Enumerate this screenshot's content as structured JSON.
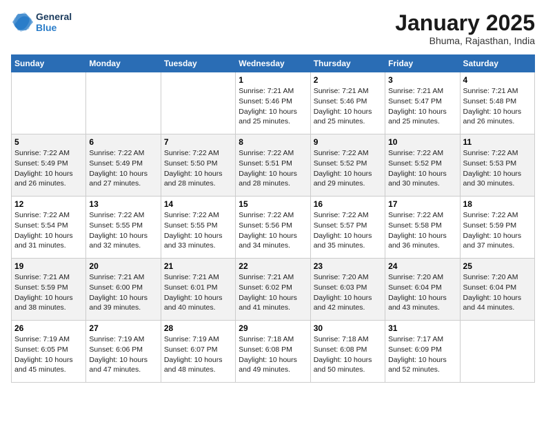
{
  "logo": {
    "line1": "General",
    "line2": "Blue"
  },
  "title": "January 2025",
  "subtitle": "Bhuma, Rajasthan, India",
  "weekdays": [
    "Sunday",
    "Monday",
    "Tuesday",
    "Wednesday",
    "Thursday",
    "Friday",
    "Saturday"
  ],
  "weeks": [
    [
      {
        "day": "",
        "info": ""
      },
      {
        "day": "",
        "info": ""
      },
      {
        "day": "",
        "info": ""
      },
      {
        "day": "1",
        "info": "Sunrise: 7:21 AM\nSunset: 5:46 PM\nDaylight: 10 hours\nand 25 minutes."
      },
      {
        "day": "2",
        "info": "Sunrise: 7:21 AM\nSunset: 5:46 PM\nDaylight: 10 hours\nand 25 minutes."
      },
      {
        "day": "3",
        "info": "Sunrise: 7:21 AM\nSunset: 5:47 PM\nDaylight: 10 hours\nand 25 minutes."
      },
      {
        "day": "4",
        "info": "Sunrise: 7:21 AM\nSunset: 5:48 PM\nDaylight: 10 hours\nand 26 minutes."
      }
    ],
    [
      {
        "day": "5",
        "info": "Sunrise: 7:22 AM\nSunset: 5:49 PM\nDaylight: 10 hours\nand 26 minutes."
      },
      {
        "day": "6",
        "info": "Sunrise: 7:22 AM\nSunset: 5:49 PM\nDaylight: 10 hours\nand 27 minutes."
      },
      {
        "day": "7",
        "info": "Sunrise: 7:22 AM\nSunset: 5:50 PM\nDaylight: 10 hours\nand 28 minutes."
      },
      {
        "day": "8",
        "info": "Sunrise: 7:22 AM\nSunset: 5:51 PM\nDaylight: 10 hours\nand 28 minutes."
      },
      {
        "day": "9",
        "info": "Sunrise: 7:22 AM\nSunset: 5:52 PM\nDaylight: 10 hours\nand 29 minutes."
      },
      {
        "day": "10",
        "info": "Sunrise: 7:22 AM\nSunset: 5:52 PM\nDaylight: 10 hours\nand 30 minutes."
      },
      {
        "day": "11",
        "info": "Sunrise: 7:22 AM\nSunset: 5:53 PM\nDaylight: 10 hours\nand 30 minutes."
      }
    ],
    [
      {
        "day": "12",
        "info": "Sunrise: 7:22 AM\nSunset: 5:54 PM\nDaylight: 10 hours\nand 31 minutes."
      },
      {
        "day": "13",
        "info": "Sunrise: 7:22 AM\nSunset: 5:55 PM\nDaylight: 10 hours\nand 32 minutes."
      },
      {
        "day": "14",
        "info": "Sunrise: 7:22 AM\nSunset: 5:55 PM\nDaylight: 10 hours\nand 33 minutes."
      },
      {
        "day": "15",
        "info": "Sunrise: 7:22 AM\nSunset: 5:56 PM\nDaylight: 10 hours\nand 34 minutes."
      },
      {
        "day": "16",
        "info": "Sunrise: 7:22 AM\nSunset: 5:57 PM\nDaylight: 10 hours\nand 35 minutes."
      },
      {
        "day": "17",
        "info": "Sunrise: 7:22 AM\nSunset: 5:58 PM\nDaylight: 10 hours\nand 36 minutes."
      },
      {
        "day": "18",
        "info": "Sunrise: 7:22 AM\nSunset: 5:59 PM\nDaylight: 10 hours\nand 37 minutes."
      }
    ],
    [
      {
        "day": "19",
        "info": "Sunrise: 7:21 AM\nSunset: 5:59 PM\nDaylight: 10 hours\nand 38 minutes."
      },
      {
        "day": "20",
        "info": "Sunrise: 7:21 AM\nSunset: 6:00 PM\nDaylight: 10 hours\nand 39 minutes."
      },
      {
        "day": "21",
        "info": "Sunrise: 7:21 AM\nSunset: 6:01 PM\nDaylight: 10 hours\nand 40 minutes."
      },
      {
        "day": "22",
        "info": "Sunrise: 7:21 AM\nSunset: 6:02 PM\nDaylight: 10 hours\nand 41 minutes."
      },
      {
        "day": "23",
        "info": "Sunrise: 7:20 AM\nSunset: 6:03 PM\nDaylight: 10 hours\nand 42 minutes."
      },
      {
        "day": "24",
        "info": "Sunrise: 7:20 AM\nSunset: 6:04 PM\nDaylight: 10 hours\nand 43 minutes."
      },
      {
        "day": "25",
        "info": "Sunrise: 7:20 AM\nSunset: 6:04 PM\nDaylight: 10 hours\nand 44 minutes."
      }
    ],
    [
      {
        "day": "26",
        "info": "Sunrise: 7:19 AM\nSunset: 6:05 PM\nDaylight: 10 hours\nand 45 minutes."
      },
      {
        "day": "27",
        "info": "Sunrise: 7:19 AM\nSunset: 6:06 PM\nDaylight: 10 hours\nand 47 minutes."
      },
      {
        "day": "28",
        "info": "Sunrise: 7:19 AM\nSunset: 6:07 PM\nDaylight: 10 hours\nand 48 minutes."
      },
      {
        "day": "29",
        "info": "Sunrise: 7:18 AM\nSunset: 6:08 PM\nDaylight: 10 hours\nand 49 minutes."
      },
      {
        "day": "30",
        "info": "Sunrise: 7:18 AM\nSunset: 6:08 PM\nDaylight: 10 hours\nand 50 minutes."
      },
      {
        "day": "31",
        "info": "Sunrise: 7:17 AM\nSunset: 6:09 PM\nDaylight: 10 hours\nand 52 minutes."
      },
      {
        "day": "",
        "info": ""
      }
    ]
  ]
}
